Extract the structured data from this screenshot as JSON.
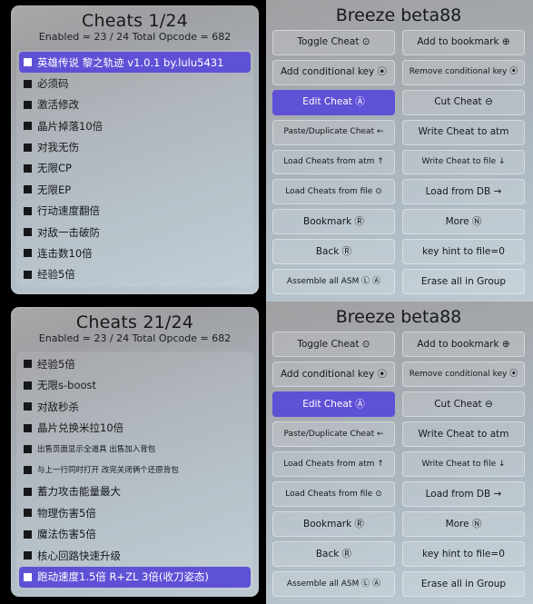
{
  "instances": [
    {
      "cheats": {
        "title": "Cheats 1/24",
        "subtitle": "Enabled = 23 / 24  Total Opcode = 682",
        "rows": [
          {
            "label": "英雄传说 黎之轨迹 v1.0.1 by.lulu5431",
            "selected": true,
            "small": false
          },
          {
            "label": "必须码",
            "selected": false,
            "small": false
          },
          {
            "label": "激活修改",
            "selected": false,
            "small": false
          },
          {
            "label": "晶片掉落10倍",
            "selected": false,
            "small": false
          },
          {
            "label": "对我无伤",
            "selected": false,
            "small": false
          },
          {
            "label": "无限CP",
            "selected": false,
            "small": false
          },
          {
            "label": "无限EP",
            "selected": false,
            "small": false
          },
          {
            "label": "行动速度翻倍",
            "selected": false,
            "small": false
          },
          {
            "label": "对敌一击破防",
            "selected": false,
            "small": false
          },
          {
            "label": "连击数10倍",
            "selected": false,
            "small": false
          },
          {
            "label": "经验5倍",
            "selected": false,
            "small": false
          }
        ]
      },
      "breeze": {
        "title": "Breeze beta88",
        "buttons": [
          {
            "label": "Toggle Cheat ⊙",
            "active": false,
            "small": false
          },
          {
            "label": "Add to bookmark ⊕",
            "active": false,
            "small": false
          },
          {
            "label": "Add conditional key ⦿",
            "active": false,
            "small": false
          },
          {
            "label": "Remove conditional key ⦿",
            "active": false,
            "small": true
          },
          {
            "label": "Edit Cheat Ⓐ",
            "active": true,
            "small": false
          },
          {
            "label": "Cut Cheat ⊖",
            "active": false,
            "small": false
          },
          {
            "label": "Paste/Duplicate Cheat ←",
            "active": false,
            "small": true
          },
          {
            "label": "Write Cheat to atm",
            "active": false,
            "small": false
          },
          {
            "label": "Load Cheats from atm ↑",
            "active": false,
            "small": true
          },
          {
            "label": "Write Cheat to file ↓",
            "active": false,
            "small": true
          },
          {
            "label": "Load Cheats from file ⊙",
            "active": false,
            "small": true
          },
          {
            "label": "Load from DB →",
            "active": false,
            "small": false
          },
          {
            "label": "Bookmark Ⓡ",
            "active": false,
            "small": false
          },
          {
            "label": "More Ⓝ",
            "active": false,
            "small": false
          },
          {
            "label": "Back Ⓡ",
            "active": false,
            "small": false
          },
          {
            "label": "key hint to file=0",
            "active": false,
            "small": false
          },
          {
            "label": "Assemble all ASM Ⓛ Ⓐ",
            "active": false,
            "small": true
          },
          {
            "label": "Erase all in Group",
            "active": false,
            "small": false
          }
        ]
      }
    },
    {
      "cheats": {
        "title": "Cheats 21/24",
        "subtitle": "Enabled = 23 / 24  Total Opcode = 682",
        "rows": [
          {
            "label": "经验5倍",
            "selected": false,
            "small": false
          },
          {
            "label": "无限s-boost",
            "selected": false,
            "small": false
          },
          {
            "label": "对敌秒杀",
            "selected": false,
            "small": false
          },
          {
            "label": "晶片兑换米拉10倍",
            "selected": false,
            "small": false
          },
          {
            "label": "出售页面显示全道具 出售加入背包",
            "selected": false,
            "small": true
          },
          {
            "label": "与上一行同时打开 改完关闭俩个还原背包",
            "selected": false,
            "small": true
          },
          {
            "label": "蓄力攻击能量最大",
            "selected": false,
            "small": false
          },
          {
            "label": "物理伤害5倍",
            "selected": false,
            "small": false
          },
          {
            "label": "魔法伤害5倍",
            "selected": false,
            "small": false
          },
          {
            "label": "核心回路快速升级",
            "selected": false,
            "small": false
          },
          {
            "label": "跑动速度1.5倍 R+ZL 3倍(收刀姿态)",
            "selected": true,
            "small": false
          }
        ]
      },
      "breeze": {
        "title": "Breeze beta88",
        "buttons": [
          {
            "label": "Toggle Cheat ⊙",
            "active": false,
            "small": false
          },
          {
            "label": "Add to bookmark ⊕",
            "active": false,
            "small": false
          },
          {
            "label": "Add conditional key ⦿",
            "active": false,
            "small": false
          },
          {
            "label": "Remove conditional key ⦿",
            "active": false,
            "small": true
          },
          {
            "label": "Edit Cheat Ⓐ",
            "active": true,
            "small": false
          },
          {
            "label": "Cut Cheat ⊖",
            "active": false,
            "small": false
          },
          {
            "label": "Paste/Duplicate Cheat ←",
            "active": false,
            "small": true
          },
          {
            "label": "Write Cheat to atm",
            "active": false,
            "small": false
          },
          {
            "label": "Load Cheats from atm ↑",
            "active": false,
            "small": true
          },
          {
            "label": "Write Cheat to file ↓",
            "active": false,
            "small": true
          },
          {
            "label": "Load Cheats from file ⊙",
            "active": false,
            "small": true
          },
          {
            "label": "Load from DB →",
            "active": false,
            "small": false
          },
          {
            "label": "Bookmark Ⓡ",
            "active": false,
            "small": false
          },
          {
            "label": "More Ⓝ",
            "active": false,
            "small": false
          },
          {
            "label": "Back Ⓡ",
            "active": false,
            "small": false
          },
          {
            "label": "key hint to file=0",
            "active": false,
            "small": false
          },
          {
            "label": "Assemble all ASM Ⓛ Ⓐ",
            "active": false,
            "small": true
          },
          {
            "label": "Erase all in Group",
            "active": false,
            "small": false
          }
        ]
      }
    }
  ],
  "colors": {
    "accent": "#5f51d6",
    "panel_light": "#bdcad4",
    "panel_dark": "#a0a0a2",
    "text": "#16181b",
    "background": "#000000"
  }
}
